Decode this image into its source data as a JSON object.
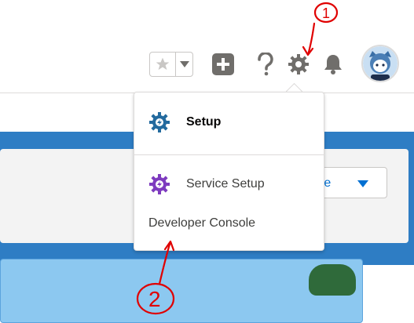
{
  "toolbar": {
    "favorites_icon": "star-icon",
    "favorites_dropdown_icon": "chevron-down-icon",
    "add_icon": "plus-icon",
    "help_icon": "question-icon",
    "setup_icon": "gear-icon",
    "notifications_icon": "bell-icon",
    "avatar_icon": "astro-avatar"
  },
  "background_page": {
    "button_label": "ate"
  },
  "setup_menu": {
    "items": [
      {
        "label": "Setup",
        "icon": "gear-icon"
      },
      {
        "label": "Service Setup",
        "icon": "gear-lightning-icon"
      },
      {
        "label": "Developer Console"
      }
    ]
  },
  "annotations": {
    "marks": [
      "1",
      "2"
    ],
    "color": "#e00000"
  },
  "colors": {
    "setup_blue": "#236a9e",
    "service_purple": "#7e3bbf",
    "icon_gray": "#706e6b",
    "link_blue": "#0070d2"
  }
}
